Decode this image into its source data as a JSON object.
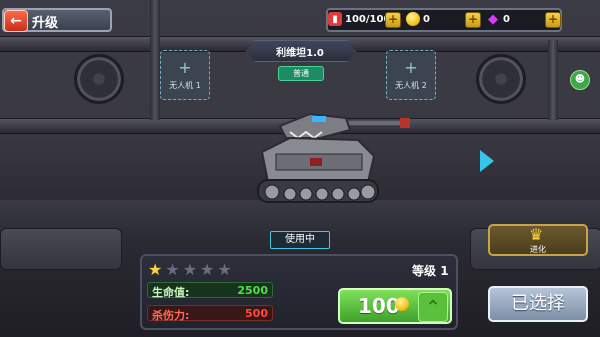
{
  "header": {
    "back_icon": "back-arrow-icon",
    "title": "升级"
  },
  "resources": [
    {
      "name": "fuel",
      "icon": "fuel-can-icon",
      "value": "100/100",
      "color": "#e03a3a"
    },
    {
      "name": "coins",
      "icon": "coin-icon",
      "value": "0",
      "color": "#f5c21a"
    },
    {
      "name": "gems",
      "icon": "gem-icon",
      "value": "0",
      "color": "#d83aff"
    }
  ],
  "drones": {
    "slot1": "无人机 1",
    "slot2": "无人机 2"
  },
  "tank": {
    "name": "利维坦1.0",
    "rarity": "普通",
    "status": "使用中"
  },
  "evolve": {
    "icon": "crown-icon",
    "label": "进化"
  },
  "stats": {
    "stars_filled": 1,
    "stars_total": 5,
    "level_label": "等级",
    "level_value": "1",
    "hp_label": "生命值:",
    "hp_value": "2500",
    "damage_label": "杀伤力:",
    "damage_value": "500"
  },
  "upgrade": {
    "cost": "100",
    "icon": "chevron-up-icon"
  },
  "select_label": "已选择",
  "colors": {
    "accent_cyan": "#35c6ea",
    "upgrade_green": "#5bc13c",
    "hp_green": "#4fe04a",
    "damage_red": "#ff4a3a",
    "gold": "#ffd23a"
  }
}
